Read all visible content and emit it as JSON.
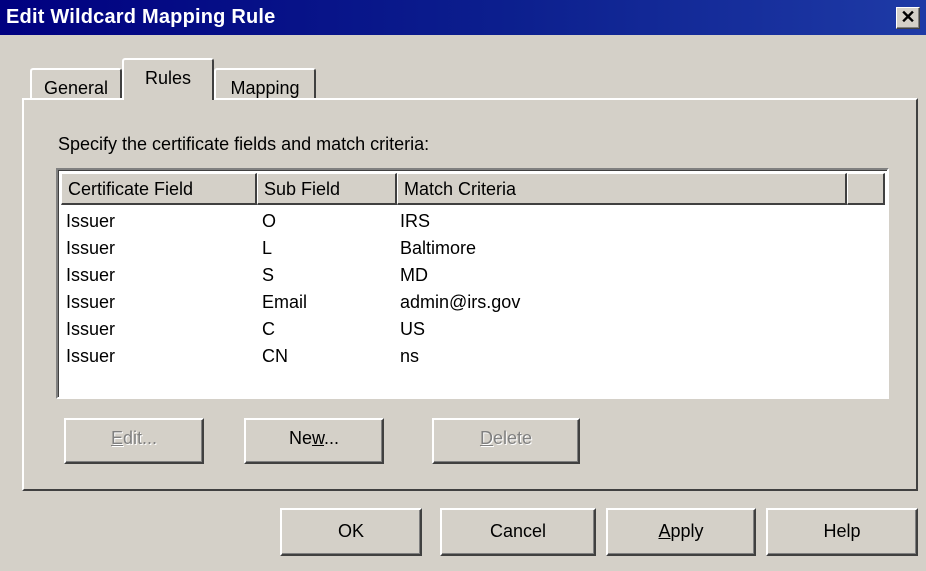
{
  "window": {
    "title": "Edit Wildcard Mapping Rule",
    "close_glyph": "✕"
  },
  "tabs": [
    {
      "label": "General"
    },
    {
      "label": "Rules",
      "selected": true
    },
    {
      "label": "Mapping"
    }
  ],
  "instruction": "Specify the certificate fields and match criteria:",
  "table": {
    "columns": [
      "Certificate Field",
      "Sub Field",
      "Match Criteria",
      ""
    ],
    "rows": [
      [
        "Issuer",
        "O",
        "IRS"
      ],
      [
        "Issuer",
        "L",
        "Baltimore"
      ],
      [
        "Issuer",
        "S",
        "MD"
      ],
      [
        "Issuer",
        "Email",
        "admin@irs.gov"
      ],
      [
        "Issuer",
        "C",
        "US"
      ],
      [
        "Issuer",
        "CN",
        "ns"
      ]
    ]
  },
  "rule_buttons": {
    "edit": {
      "mnemonic": "E",
      "rest": "dit...",
      "enabled": false
    },
    "new": {
      "before": "Ne",
      "mnemonic": "w",
      "rest": "...",
      "enabled": true
    },
    "delete": {
      "mnemonic": "D",
      "rest": "elete",
      "enabled": false
    }
  },
  "footer_buttons": {
    "ok": "OK",
    "cancel": "Cancel",
    "apply": {
      "mnemonic": "A",
      "rest": "pply"
    },
    "help": "Help"
  }
}
